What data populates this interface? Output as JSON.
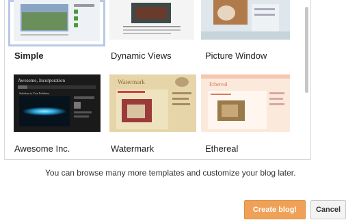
{
  "templates": [
    {
      "name": "Simple",
      "selected": true
    },
    {
      "name": "Dynamic Views",
      "selected": false
    },
    {
      "name": "Picture Window",
      "selected": false
    },
    {
      "name": "Awesome Inc.",
      "selected": false,
      "thumb_title": "Awesome, Incorporation",
      "thumb_subtitle": "Solutions to Your Problems"
    },
    {
      "name": "Watermark",
      "selected": false,
      "thumb_title": "Watermark"
    },
    {
      "name": "Ethereal",
      "selected": false,
      "thumb_title": "Ethereal"
    }
  ],
  "info_text": "You can browse many more templates and customize your blog later.",
  "buttons": {
    "create": "Create blog!",
    "cancel": "Cancel"
  },
  "colors": {
    "accent": "#f0a158",
    "selection": "#b7c9e6"
  }
}
